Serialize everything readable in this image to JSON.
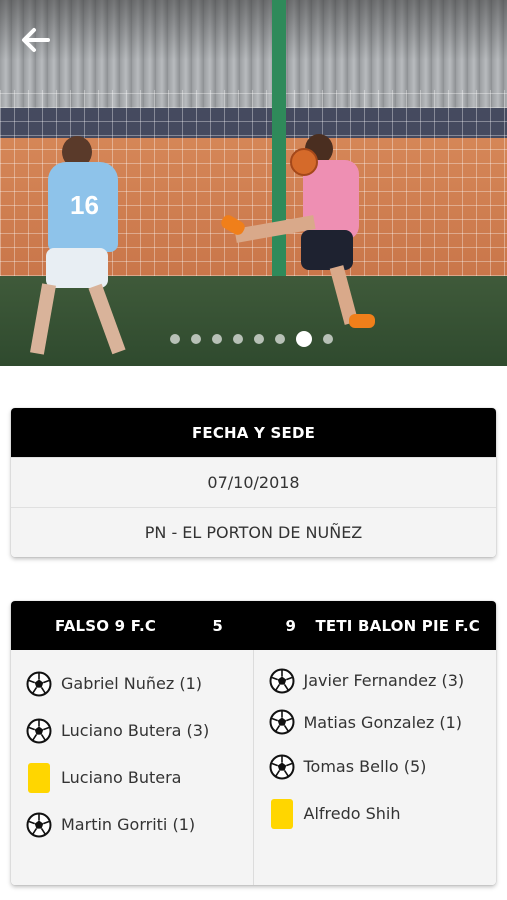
{
  "hero": {
    "carousel_total": 8,
    "carousel_active_index": 6,
    "jersey_number": "16"
  },
  "match_info": {
    "header": "FECHA Y SEDE",
    "date": "07/10/2018",
    "venue": "PN - EL PORTON DE NUÑEZ"
  },
  "score": {
    "home_team": "FALSO 9 F.C",
    "home_goals": "5",
    "away_goals": "9",
    "away_team": "TETI BALON PIE F.C"
  },
  "home_events": [
    {
      "type": "goal",
      "icon": "soccer-ball-icon",
      "text": "Gabriel Nuñez (1)"
    },
    {
      "type": "goal",
      "icon": "soccer-ball-icon",
      "text": "Luciano Butera (3)"
    },
    {
      "type": "yellow-card",
      "icon": "yellow-card-icon",
      "text": "Luciano Butera"
    },
    {
      "type": "goal",
      "icon": "soccer-ball-icon",
      "text": "Martin Gorriti (1)"
    }
  ],
  "away_events": [
    {
      "type": "goal",
      "icon": "soccer-ball-icon",
      "text": "Javier Fernandez (3)"
    },
    {
      "type": "goal",
      "icon": "soccer-ball-icon",
      "text": "Matias Gonzalez (1)"
    },
    {
      "type": "goal",
      "icon": "soccer-ball-icon",
      "text": "Tomas Bello (5)"
    },
    {
      "type": "yellow-card",
      "icon": "yellow-card-icon",
      "text": "Alfredo Shih"
    }
  ],
  "colors": {
    "header_bg": "#000000",
    "yellow_card": "#ffd600",
    "panel_bg": "#f4f4f4"
  }
}
